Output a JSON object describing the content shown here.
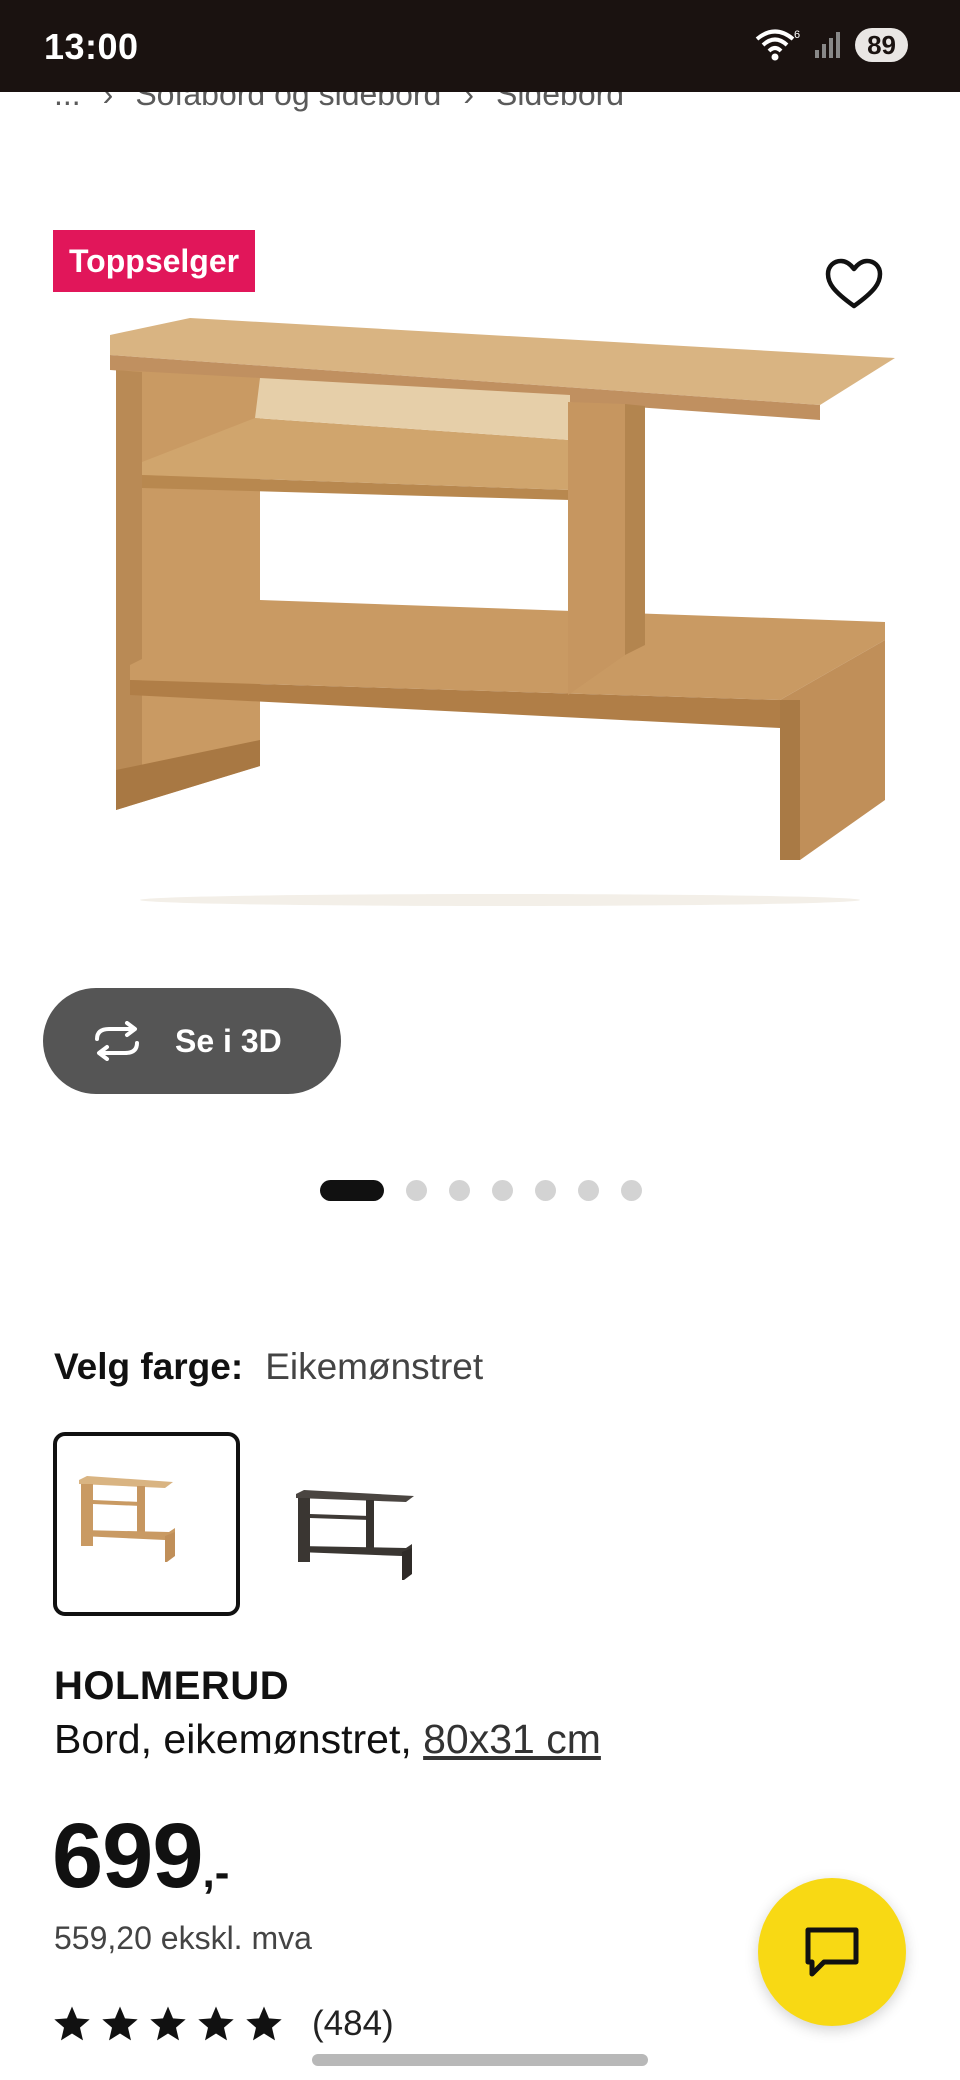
{
  "status_bar": {
    "time": "13:00",
    "battery": "89",
    "wifi_badge": "6"
  },
  "breadcrumb": {
    "items": [
      "...",
      "Sofabord og sidebord",
      "Sidebord"
    ]
  },
  "product": {
    "badge": "Toppselger",
    "view3d_label": "Se i 3D",
    "color_label": "Velg farge:",
    "color_value": "Eikemønstret",
    "name": "HOLMERUD",
    "description": "Bord, eikemønstret, ",
    "size": "80x31 cm",
    "price": "699",
    "price_suffix": ",-",
    "price_excl_vat": "559,20 ekskl. mva",
    "rating": 5,
    "rating_count": "(484)"
  },
  "carousel": {
    "total": 7,
    "active": 1
  },
  "colors": {
    "badge_bg": "#e1165a",
    "fab_bg": "#f8d914",
    "button_bg": "#555555",
    "oak": "#c9a06b",
    "dark": "#3a3632"
  },
  "icons": [
    "wifi-icon",
    "signal-icon",
    "heart-icon",
    "rotate-3d-icon",
    "star-icon",
    "chat-icon"
  ]
}
